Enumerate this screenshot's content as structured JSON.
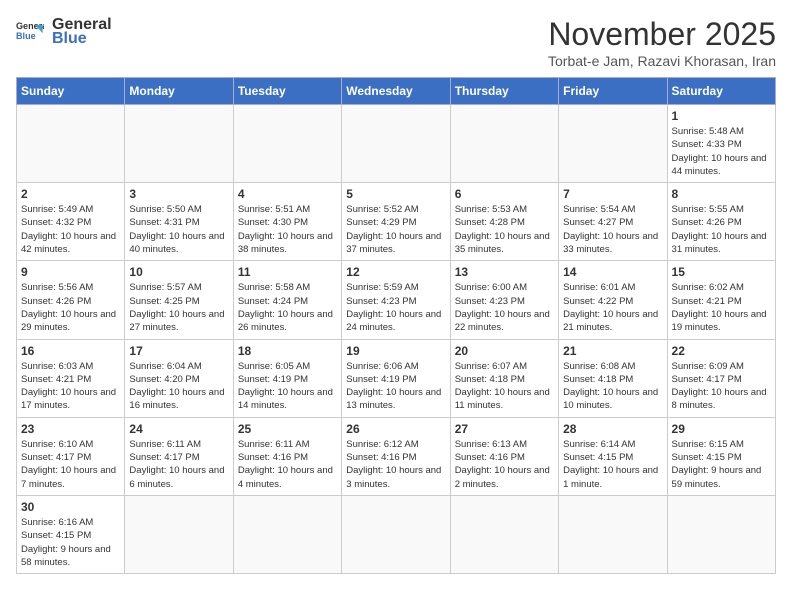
{
  "header": {
    "logo_line1": "General",
    "logo_line2": "Blue",
    "title": "November 2025",
    "subtitle": "Torbat-e Jam, Razavi Khorasan, Iran"
  },
  "weekdays": [
    "Sunday",
    "Monday",
    "Tuesday",
    "Wednesday",
    "Thursday",
    "Friday",
    "Saturday"
  ],
  "weeks": [
    [
      {
        "day": "",
        "info": ""
      },
      {
        "day": "",
        "info": ""
      },
      {
        "day": "",
        "info": ""
      },
      {
        "day": "",
        "info": ""
      },
      {
        "day": "",
        "info": ""
      },
      {
        "day": "",
        "info": ""
      },
      {
        "day": "1",
        "info": "Sunrise: 5:48 AM\nSunset: 4:33 PM\nDaylight: 10 hours and 44 minutes."
      }
    ],
    [
      {
        "day": "2",
        "info": "Sunrise: 5:49 AM\nSunset: 4:32 PM\nDaylight: 10 hours and 42 minutes."
      },
      {
        "day": "3",
        "info": "Sunrise: 5:50 AM\nSunset: 4:31 PM\nDaylight: 10 hours and 40 minutes."
      },
      {
        "day": "4",
        "info": "Sunrise: 5:51 AM\nSunset: 4:30 PM\nDaylight: 10 hours and 38 minutes."
      },
      {
        "day": "5",
        "info": "Sunrise: 5:52 AM\nSunset: 4:29 PM\nDaylight: 10 hours and 37 minutes."
      },
      {
        "day": "6",
        "info": "Sunrise: 5:53 AM\nSunset: 4:28 PM\nDaylight: 10 hours and 35 minutes."
      },
      {
        "day": "7",
        "info": "Sunrise: 5:54 AM\nSunset: 4:27 PM\nDaylight: 10 hours and 33 minutes."
      },
      {
        "day": "8",
        "info": "Sunrise: 5:55 AM\nSunset: 4:26 PM\nDaylight: 10 hours and 31 minutes."
      }
    ],
    [
      {
        "day": "9",
        "info": "Sunrise: 5:56 AM\nSunset: 4:26 PM\nDaylight: 10 hours and 29 minutes."
      },
      {
        "day": "10",
        "info": "Sunrise: 5:57 AM\nSunset: 4:25 PM\nDaylight: 10 hours and 27 minutes."
      },
      {
        "day": "11",
        "info": "Sunrise: 5:58 AM\nSunset: 4:24 PM\nDaylight: 10 hours and 26 minutes."
      },
      {
        "day": "12",
        "info": "Sunrise: 5:59 AM\nSunset: 4:23 PM\nDaylight: 10 hours and 24 minutes."
      },
      {
        "day": "13",
        "info": "Sunrise: 6:00 AM\nSunset: 4:23 PM\nDaylight: 10 hours and 22 minutes."
      },
      {
        "day": "14",
        "info": "Sunrise: 6:01 AM\nSunset: 4:22 PM\nDaylight: 10 hours and 21 minutes."
      },
      {
        "day": "15",
        "info": "Sunrise: 6:02 AM\nSunset: 4:21 PM\nDaylight: 10 hours and 19 minutes."
      }
    ],
    [
      {
        "day": "16",
        "info": "Sunrise: 6:03 AM\nSunset: 4:21 PM\nDaylight: 10 hours and 17 minutes."
      },
      {
        "day": "17",
        "info": "Sunrise: 6:04 AM\nSunset: 4:20 PM\nDaylight: 10 hours and 16 minutes."
      },
      {
        "day": "18",
        "info": "Sunrise: 6:05 AM\nSunset: 4:19 PM\nDaylight: 10 hours and 14 minutes."
      },
      {
        "day": "19",
        "info": "Sunrise: 6:06 AM\nSunset: 4:19 PM\nDaylight: 10 hours and 13 minutes."
      },
      {
        "day": "20",
        "info": "Sunrise: 6:07 AM\nSunset: 4:18 PM\nDaylight: 10 hours and 11 minutes."
      },
      {
        "day": "21",
        "info": "Sunrise: 6:08 AM\nSunset: 4:18 PM\nDaylight: 10 hours and 10 minutes."
      },
      {
        "day": "22",
        "info": "Sunrise: 6:09 AM\nSunset: 4:17 PM\nDaylight: 10 hours and 8 minutes."
      }
    ],
    [
      {
        "day": "23",
        "info": "Sunrise: 6:10 AM\nSunset: 4:17 PM\nDaylight: 10 hours and 7 minutes."
      },
      {
        "day": "24",
        "info": "Sunrise: 6:11 AM\nSunset: 4:17 PM\nDaylight: 10 hours and 6 minutes."
      },
      {
        "day": "25",
        "info": "Sunrise: 6:11 AM\nSunset: 4:16 PM\nDaylight: 10 hours and 4 minutes."
      },
      {
        "day": "26",
        "info": "Sunrise: 6:12 AM\nSunset: 4:16 PM\nDaylight: 10 hours and 3 minutes."
      },
      {
        "day": "27",
        "info": "Sunrise: 6:13 AM\nSunset: 4:16 PM\nDaylight: 10 hours and 2 minutes."
      },
      {
        "day": "28",
        "info": "Sunrise: 6:14 AM\nSunset: 4:15 PM\nDaylight: 10 hours and 1 minute."
      },
      {
        "day": "29",
        "info": "Sunrise: 6:15 AM\nSunset: 4:15 PM\nDaylight: 9 hours and 59 minutes."
      }
    ],
    [
      {
        "day": "30",
        "info": "Sunrise: 6:16 AM\nSunset: 4:15 PM\nDaylight: 9 hours and 58 minutes."
      },
      {
        "day": "",
        "info": ""
      },
      {
        "day": "",
        "info": ""
      },
      {
        "day": "",
        "info": ""
      },
      {
        "day": "",
        "info": ""
      },
      {
        "day": "",
        "info": ""
      },
      {
        "day": "",
        "info": ""
      }
    ]
  ]
}
